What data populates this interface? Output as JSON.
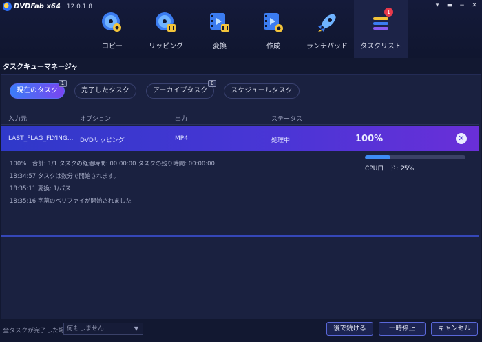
{
  "app": {
    "name": "DVDFab x64",
    "version": "12.0.1.8"
  },
  "window_controls": [
    "▾",
    "▬",
    "−",
    "✕"
  ],
  "modules": [
    {
      "label": "コピー",
      "icon": "copy-disc-icon",
      "active": false
    },
    {
      "label": "リッピング",
      "icon": "ripper-disc-icon",
      "active": false
    },
    {
      "label": "変換",
      "icon": "converter-film-icon",
      "active": false
    },
    {
      "label": "作成",
      "icon": "creator-film-icon",
      "active": false
    },
    {
      "label": "ランチパッド",
      "icon": "launchpad-rocket-icon",
      "active": false
    },
    {
      "label": "タスクリスト",
      "icon": "tasklist-icon",
      "active": true,
      "badge": "1"
    }
  ],
  "section_title": "タスクキューマネージャ",
  "tabs": [
    {
      "label": "現在のタスク",
      "count": "1",
      "active": true
    },
    {
      "label": "完了したタスク",
      "count": "",
      "active": false
    },
    {
      "label": "アーカイブタスク",
      "count": "0",
      "active": false
    },
    {
      "label": "スケジュールタスク",
      "count": "",
      "active": false
    }
  ],
  "columns": {
    "source": "入力元",
    "option": "オプション",
    "output": "出力",
    "status": "ステータス"
  },
  "task": {
    "source": "LAST_FLAG_FLYING...",
    "option": "DVDリッピング",
    "output": "MP4",
    "status": "処理中",
    "progress_label": "100%",
    "progress": 1.0
  },
  "details": [
    "100%　合計: 1/1  タスクの経過時間: 00:00:00  タスクの残り時間: 00:00:00",
    "18:34:57  タスクは数分で開始されます。",
    "18:35:11  変換: 1/パス",
    "18:35:16  字幕のベリファイが開始されました"
  ],
  "cpu": {
    "label": "CPUロード: 25%",
    "load": 0.25
  },
  "footer": {
    "label": "全タスクが完了した場合:",
    "select_value": "何もしません",
    "buttons": {
      "later": "後で続ける",
      "pause": "一時停止",
      "cancel": "キャンセル"
    }
  },
  "colors": {
    "accent_blue": "#3a7df6",
    "accent_purple": "#7a44f0",
    "badge_red": "#e8394a"
  }
}
